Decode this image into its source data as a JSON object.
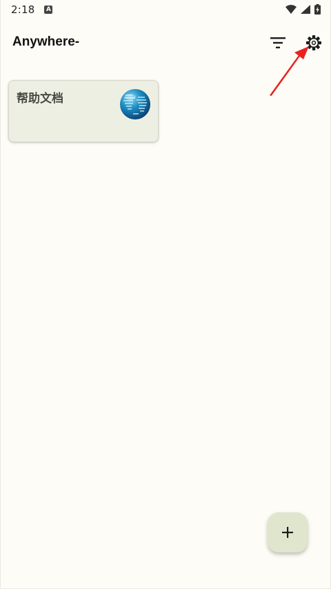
{
  "status_bar": {
    "time": "2:18",
    "notification_icon": "a-icon",
    "wifi_icon": "wifi-icon",
    "signal_icon": "signal-icon",
    "battery_icon": "battery-charging-icon"
  },
  "app_bar": {
    "title": "Anywhere-",
    "filter_icon": "filter-icon",
    "settings_icon": "gear-icon"
  },
  "cards": [
    {
      "title": "帮助文档",
      "icon": "globe-icon"
    }
  ],
  "fab": {
    "icon": "plus-icon"
  },
  "colors": {
    "background": "#fdfcf6",
    "card": "#eeefe3",
    "fab": "#dfe6cd",
    "annotation": "#e8231d"
  }
}
